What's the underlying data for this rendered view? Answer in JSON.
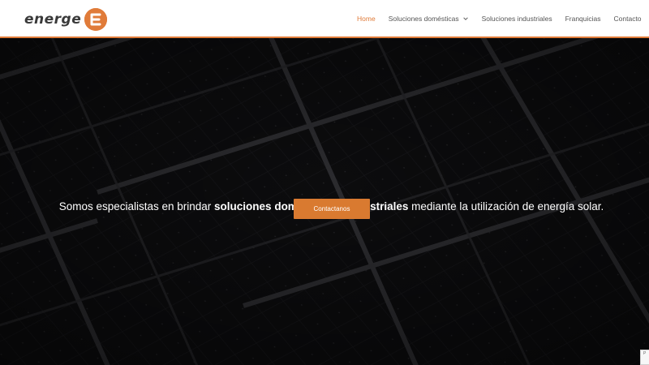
{
  "header": {
    "logo_text": "energe",
    "logo_letter": "E",
    "nav": [
      {
        "label": "Home",
        "active": true
      },
      {
        "label": "Soluciones domésticas",
        "has_dropdown": true
      },
      {
        "label": "Soluciones industriales"
      },
      {
        "label": "Franquicias"
      },
      {
        "label": "Contacto"
      }
    ]
  },
  "hero": {
    "text_before": "Somos especialistas en brindar ",
    "text_bold": "soluciones domésticas e industriales",
    "text_after": " mediante la utilización de energía solar.",
    "cta_label": "Contactanos"
  },
  "colors": {
    "accent": "#e07b39",
    "button": "#d97a30",
    "hero_bg": "#0c0c0e"
  },
  "recaptcha_badge": "P"
}
